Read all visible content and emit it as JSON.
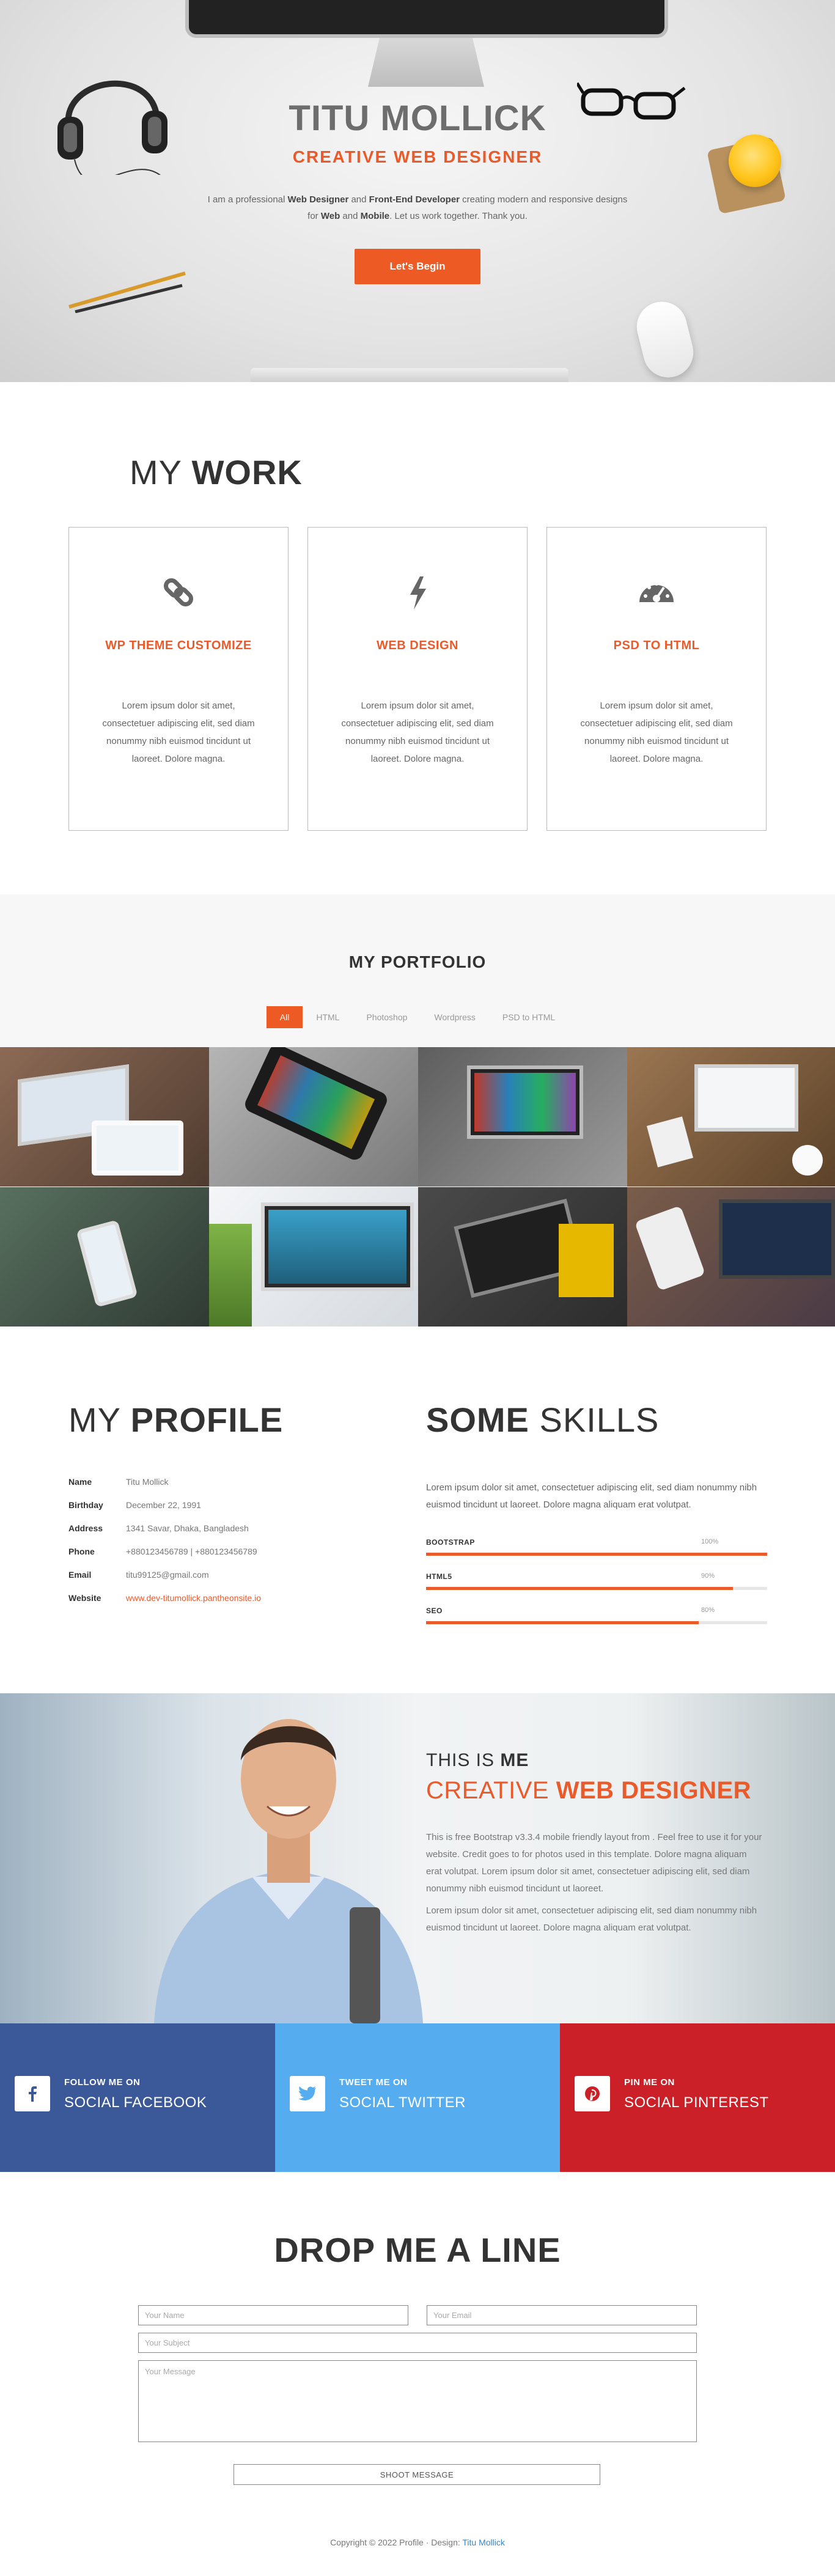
{
  "hero": {
    "title": "TITU MOLLICK",
    "subtitle": "CREATIVE WEB DESIGNER",
    "intro": {
      "p1": "I am a professional ",
      "b1": "Web Designer",
      "p2": " and ",
      "b2": "Front-End Developer",
      "p3": " creating modern and responsive designs",
      "p4": "for ",
      "b3": "Web",
      "p5": " and ",
      "b4": "Mobile",
      "p6": ". Let us work together. Thank you."
    },
    "button": "Let's Begin"
  },
  "work": {
    "title_light": "MY",
    "title_bold": "WORK",
    "cards": [
      {
        "icon": "link-icon",
        "title": "WP THEME CUSTOMIZE",
        "text": "Lorem ipsum dolor sit amet, consectetuer adipiscing elit, sed diam nonummy nibh euismod tincidunt ut laoreet. Dolore magna."
      },
      {
        "icon": "bolt-icon",
        "title": "WEB DESIGN",
        "text": "Lorem ipsum dolor sit amet, consectetuer adipiscing elit, sed diam nonummy nibh euismod tincidunt ut laoreet. Dolore magna."
      },
      {
        "icon": "dashboard-icon",
        "title": "PSD TO HTML",
        "text": "Lorem ipsum dolor sit amet, consectetuer adipiscing elit, sed diam nonummy nibh euismod tincidunt ut laoreet. Dolore magna."
      }
    ]
  },
  "portfolio": {
    "title_light": "MY",
    "title_bold": "PORTFOLIO",
    "filters": [
      "All",
      "HTML",
      "Photoshop",
      "Wordpress",
      "PSD to HTML"
    ],
    "active_filter": "All",
    "image_bg_colors": [
      "#7a5d4a",
      "#9a9a9a",
      "#6f6f6f",
      "#8b6a48",
      "#6c7b6a",
      "#e8ecef",
      "#3f3f3f",
      "#6b5d56"
    ]
  },
  "profile": {
    "title_light": "MY",
    "title_bold": "PROFILE",
    "rows": [
      {
        "label": "Name",
        "value": "Titu Mollick"
      },
      {
        "label": "Birthday",
        "value": "December 22, 1991"
      },
      {
        "label": "Address",
        "value": "1341 Savar, Dhaka, Bangladesh"
      },
      {
        "label": "Phone",
        "value": "+880123456789 | +880123456789"
      },
      {
        "label": "Email",
        "value": "titu99125@gmail.com"
      },
      {
        "label": "Website",
        "value": "www.dev-titumollick.pantheonsite.io"
      }
    ]
  },
  "skills": {
    "title_bold": "SOME",
    "title_light": "SKILLS",
    "text": "Lorem ipsum dolor sit amet, consectetuer adipiscing elit, sed diam nonummy nibh euismod tincidunt ut laoreet. Dolore magna aliquam erat volutpat.",
    "items": [
      {
        "name": "BOOTSTRAP",
        "percent_label": "100%",
        "fraction": 1.0
      },
      {
        "name": "HTML5",
        "percent_label": "90%",
        "fraction": 0.9
      },
      {
        "name": "SEO",
        "percent_label": "80%",
        "fraction": 0.8
      }
    ]
  },
  "about": {
    "small_light": "THIS IS",
    "small_bold": "ME",
    "big_light": "CREATIVE",
    "big_bold": "WEB DESIGNER",
    "p1": "This is free Bootstrap v3.3.4 mobile friendly layout from . Feel free to use it for your website. Credit goes to for photos used in this template. Dolore magna aliquam erat volutpat. Lorem ipsum dolor sit amet, consectetuer adipiscing elit, sed diam nonummy nibh euismod tincidunt ut laoreet.",
    "p2": "Lorem ipsum dolor sit amet, consectetuer adipiscing elit, sed diam nonummy nibh euismod tincidunt ut laoreet. Dolore magna aliquam erat volutpat."
  },
  "social": [
    {
      "small": "FOLLOW ME ON",
      "big": "SOCIAL FACEBOOK",
      "icon": "facebook-icon",
      "color": "#3b5998",
      "icon_color": "#3b5998"
    },
    {
      "small": "TWEET ME ON",
      "big": "SOCIAL TWITTER",
      "icon": "twitter-icon",
      "color": "#55acee",
      "icon_color": "#55acee"
    },
    {
      "small": "PIN ME ON",
      "big": "SOCIAL PINTEREST",
      "icon": "pinterest-icon",
      "color": "#cb2027",
      "icon_color": "#cb2027"
    }
  ],
  "contact": {
    "title_light": "DROP",
    "title_bold": "ME A LINE",
    "name_placeholder": "Your Name",
    "email_placeholder": "Your Email",
    "subject_placeholder": "Your Subject",
    "message_placeholder": "Your Message",
    "button": "SHOOT MESSAGE"
  },
  "footer": {
    "text": "Copyright © 2022 Profile · Design: ",
    "author": "Titu Mollick"
  },
  "colors": {
    "accent": "#e95b2b",
    "button": "#ee5a24"
  }
}
